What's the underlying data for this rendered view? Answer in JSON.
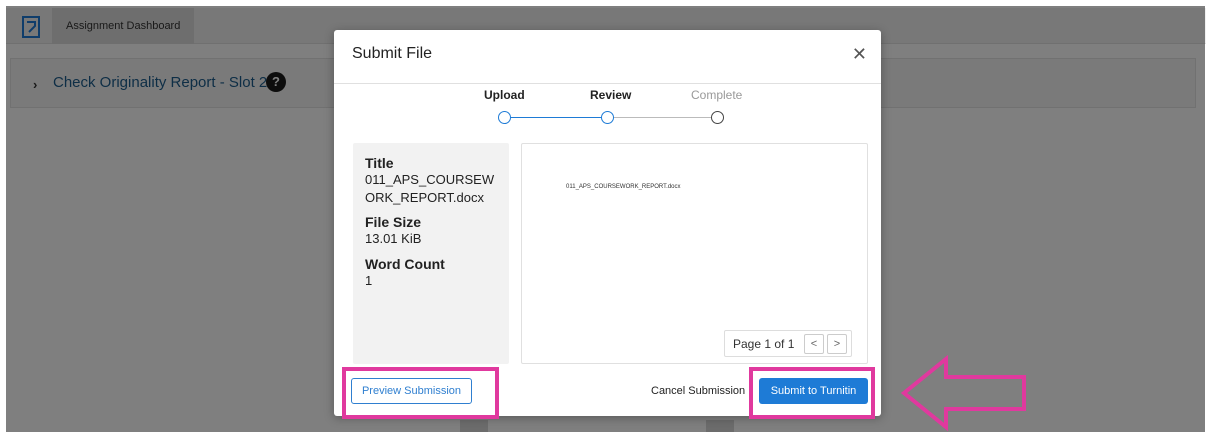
{
  "app": {
    "tab_label": "Assignment Dashboard"
  },
  "slot": {
    "title": "Check Originality Report - Slot 2",
    "help_glyph": "?"
  },
  "modal": {
    "title": "Submit File",
    "close_glyph": "✕",
    "steps": [
      {
        "label": "Upload",
        "state": "done"
      },
      {
        "label": "Review",
        "state": "active"
      },
      {
        "label": "Complete",
        "state": "pending"
      }
    ],
    "meta": {
      "title_label": "Title",
      "title_value": "011_APS_COURSEWORK_REPORT.docx",
      "size_label": "File Size",
      "size_value": "13.01 KiB",
      "count_label": "Word Count",
      "count_value": "1"
    },
    "preview": {
      "doc_name": "011_APS_COURSEWORK_REPORT.docx",
      "pager_text": "Page 1 of 1",
      "prev_glyph": "<",
      "next_glyph": ">"
    },
    "footer": {
      "preview_label": "Preview Submission",
      "cancel_label": "Cancel Submission",
      "submit_label": "Submit to Turnitin"
    }
  },
  "colors": {
    "accent": "#1e7bd6",
    "highlight": "#e0399e",
    "link": "#1d5d8c"
  },
  "annotations": {
    "arrow_icon": "outline-arrow-left-icon"
  }
}
